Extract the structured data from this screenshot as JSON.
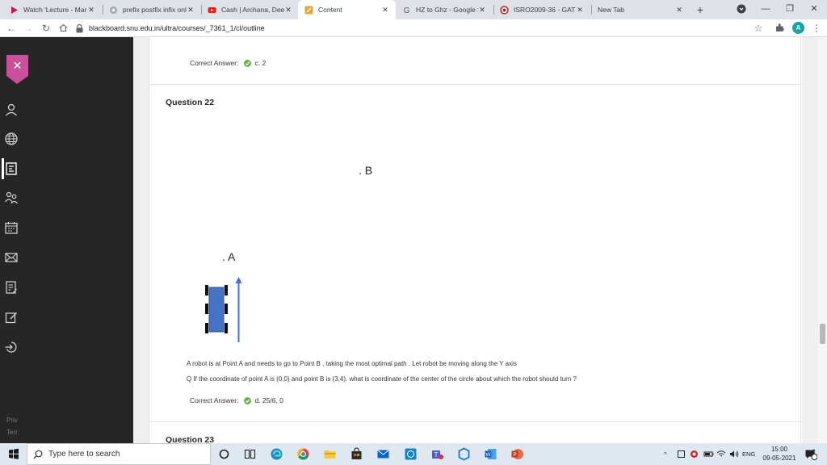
{
  "browser": {
    "tabs": [
      {
        "title": "Watch 'Lecture - Mar",
        "icon": "video-play-icon",
        "active": false
      },
      {
        "title": "prefix postfix infix onli",
        "icon": "site-icon",
        "active": false
      },
      {
        "title": "Cash | Archana, Deepi",
        "icon": "youtube-icon",
        "active": false
      },
      {
        "title": "Content",
        "icon": "blackboard-icon",
        "active": true
      },
      {
        "title": "HZ to Ghz - Google Se",
        "icon": "google-icon",
        "active": false
      },
      {
        "title": "ISRO2009-36 - GATE C",
        "icon": "gate-icon",
        "active": false
      },
      {
        "title": "New Tab",
        "icon": "",
        "active": false
      }
    ],
    "url": "blackboard.snu.edu.in/ultra/courses/_7361_1/cl/outline",
    "profile_initial": "A",
    "accent": "#1aa3a3"
  },
  "sidebar": {
    "footer": [
      "Priv",
      "Terr"
    ],
    "accent": "#c9509a"
  },
  "content": {
    "prev_answer": {
      "label": "Correct Answer:",
      "value": "c. 2"
    },
    "question": {
      "title": "Question 22",
      "point_b": ". B",
      "point_a": ". A",
      "line1": "A  robot is at Point A and needs to go to Point B , taking the most optimal path .  Let robot be moving along the Y axis",
      "line2": "Q If the coordinate of point A is (0,0) and point B is (3,4).  what is coordinate of the center of the circle about which the robot should turn ?",
      "answer_label": "Correct Answer:",
      "answer_value": "d. 25/6, 0"
    },
    "next_question_title": "Question 23"
  },
  "taskbar": {
    "search_placeholder": "Type here to search",
    "language": "ENG",
    "time": "15:00",
    "date": "09-05-2021",
    "notification_count": "2"
  }
}
